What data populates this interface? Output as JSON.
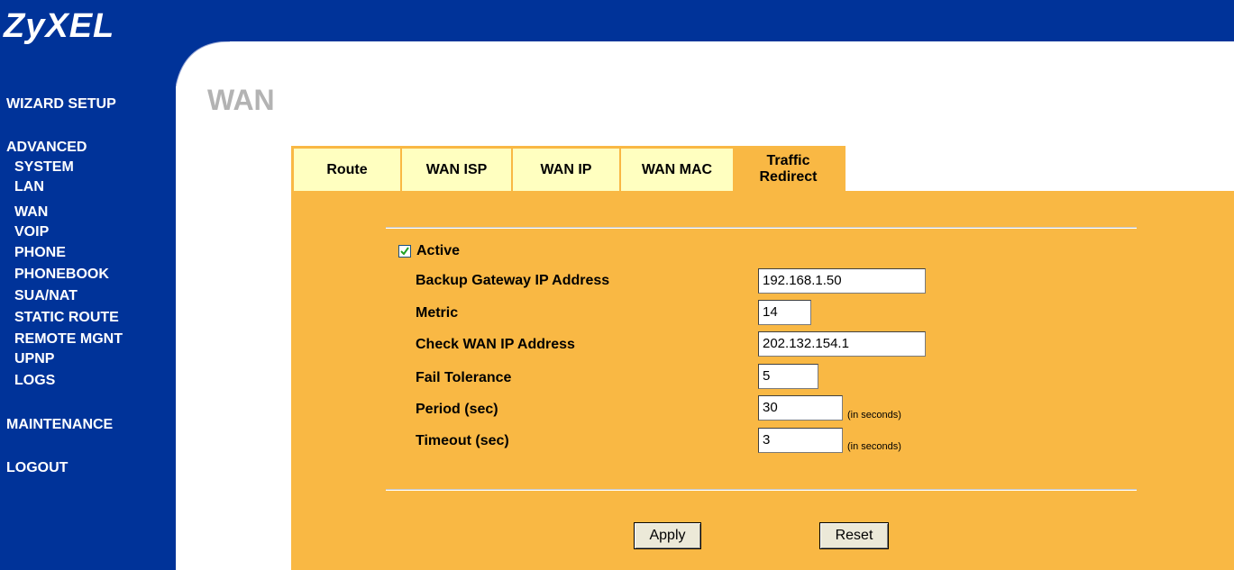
{
  "brand": {
    "logo_text": "ZyXEL"
  },
  "sidebar": {
    "wizard": "WIZARD SETUP",
    "advanced": "ADVANCED",
    "items": [
      "SYSTEM",
      "LAN",
      "WAN",
      "VOIP",
      "PHONE",
      "PHONEBOOK",
      "SUA/NAT",
      "STATIC ROUTE",
      "REMOTE MGNT",
      "UPNP",
      "LOGS"
    ],
    "maintenance": "MAINTENANCE",
    "logout": "LOGOUT"
  },
  "page": {
    "title": "WAN"
  },
  "tabs": {
    "route": "Route",
    "wan_isp": "WAN ISP",
    "wan_ip": "WAN IP",
    "wan_mac": "WAN MAC",
    "traffic_line1": "Traffic",
    "traffic_line2": "Redirect"
  },
  "form": {
    "active_label": "Active",
    "active_checked": true,
    "backup_gateway_label": "Backup Gateway IP Address",
    "backup_gateway_value": "192.168.1.50",
    "metric_label": "Metric",
    "metric_value": "14",
    "check_wan_label": "Check WAN IP Address",
    "check_wan_value": "202.132.154.1",
    "fail_tolerance_label": "Fail Tolerance",
    "fail_tolerance_value": "5",
    "period_label": "Period (sec)",
    "period_value": "30",
    "period_hint": "(in seconds)",
    "timeout_label": "Timeout (sec)",
    "timeout_value": "3",
    "timeout_hint": "(in seconds)"
  },
  "buttons": {
    "apply": "Apply",
    "reset": "Reset"
  },
  "colors": {
    "nav_blue": "#003399",
    "panel_orange": "#f9b844",
    "tab_yellow": "#ffffc0",
    "title_gray": "#b3b3b3"
  }
}
